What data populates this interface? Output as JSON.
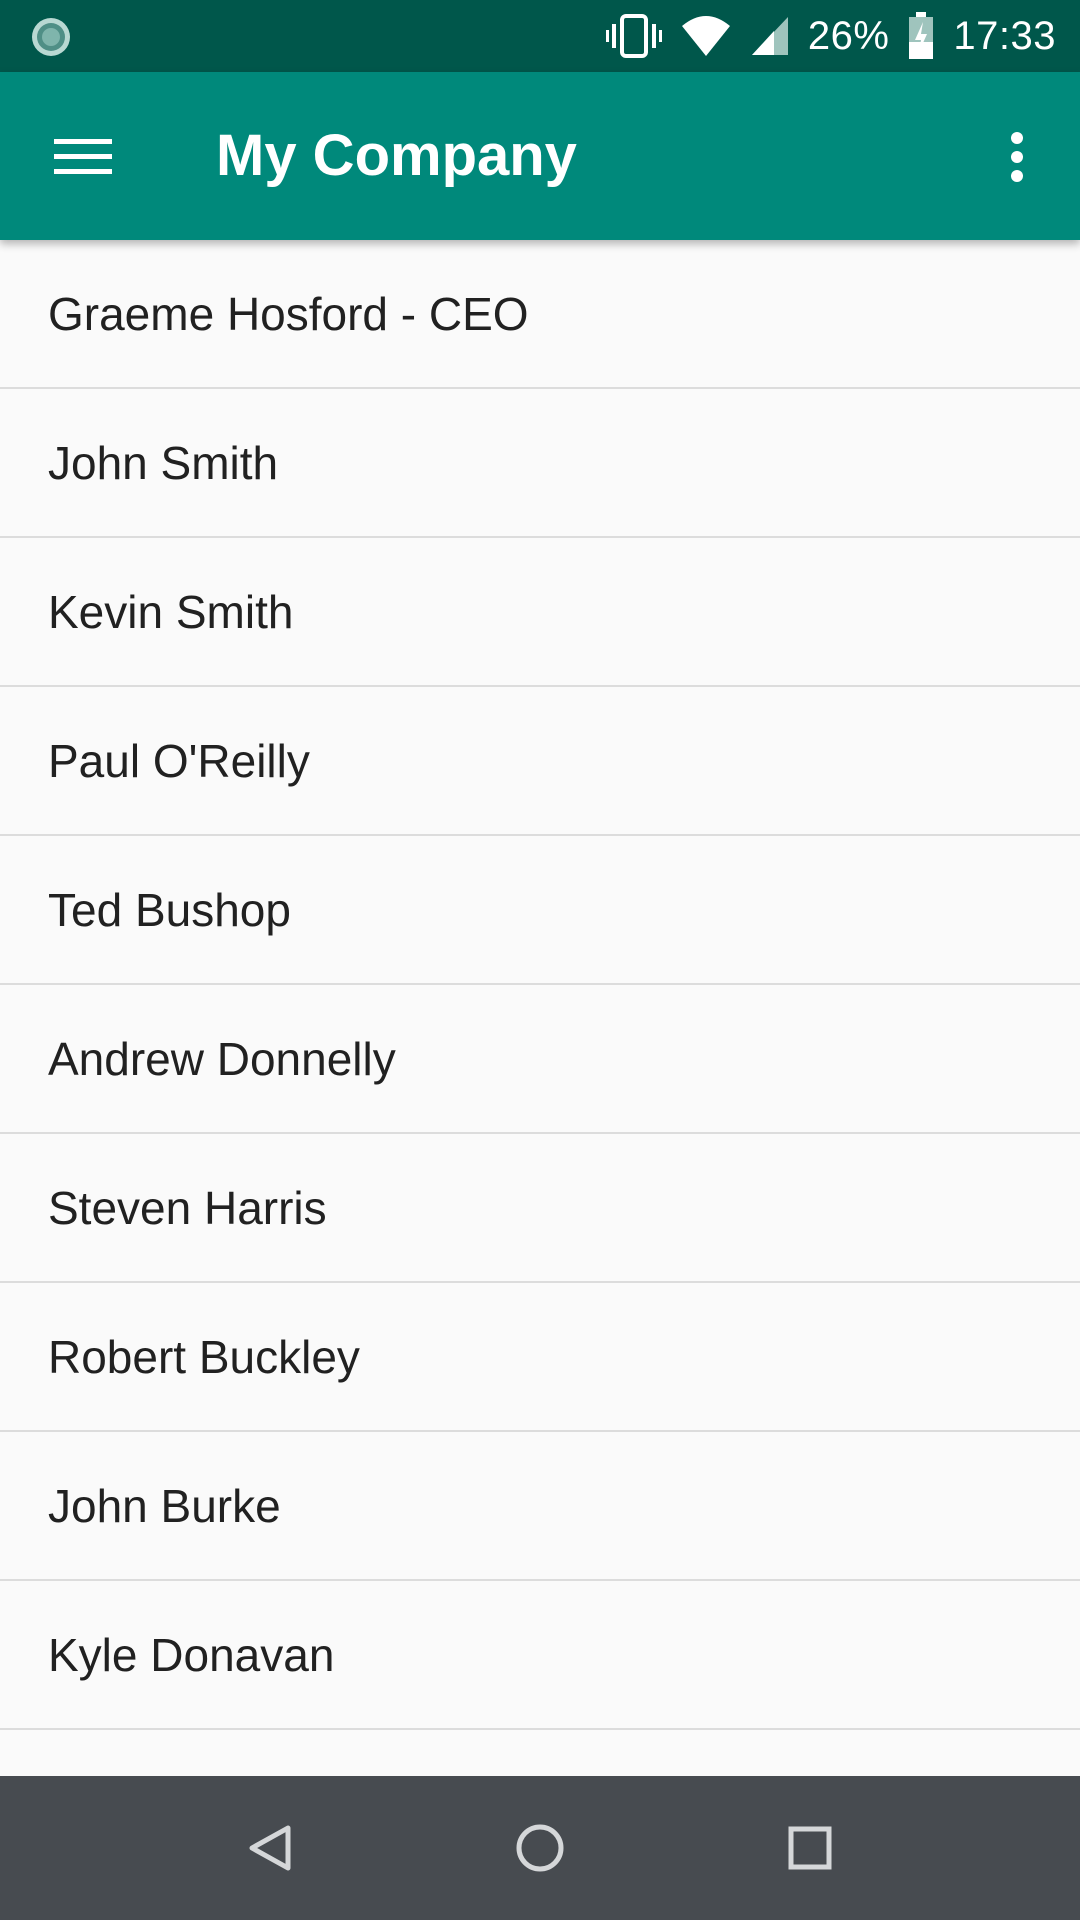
{
  "status_bar": {
    "battery": "26%",
    "time": "17:33",
    "icons": [
      "app-notification-icon",
      "vibrate-icon",
      "wifi-icon",
      "cell-signal-icon",
      "battery-charging-icon"
    ]
  },
  "app_bar": {
    "title": "My Company",
    "icons": [
      "menu-icon",
      "more-vert-icon"
    ]
  },
  "employees": [
    "Graeme Hosford - CEO",
    "John Smith",
    "Kevin Smith",
    "Paul O'Reilly",
    "Ted Bushop",
    "Andrew Donnelly",
    "Steven Harris",
    "Robert Buckley",
    "John Burke",
    "Kyle Donavan",
    ""
  ],
  "nav_bar": {
    "icons": [
      "back-icon",
      "home-icon",
      "recents-icon"
    ]
  },
  "colors": {
    "status_bar": "#00574b",
    "app_bar": "#00897b",
    "list_background": "#fafafa",
    "divider": "#dcdcdc",
    "nav_bar": "#474b50"
  }
}
